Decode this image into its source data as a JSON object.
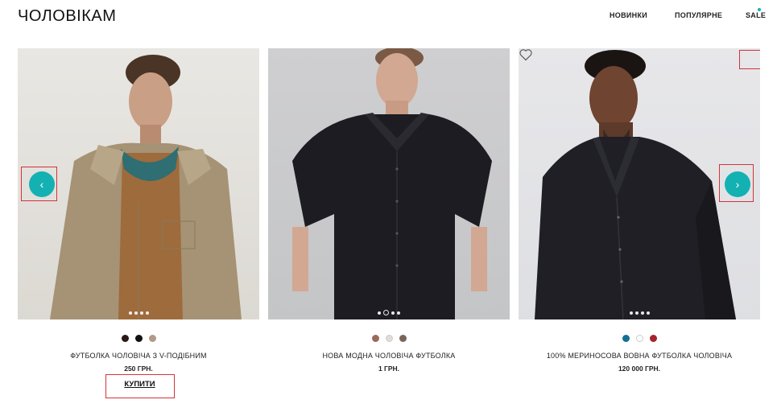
{
  "header": {
    "title": "ЧОЛОВІКАМ",
    "nav": {
      "new": "НОВИНКИ",
      "popular": "ПОПУЛЯРНЕ",
      "sale": "SALE"
    }
  },
  "accent_color": "#14b1b3",
  "highlight_color": "#d1343a",
  "icons": {
    "prev": "chevron-left-icon",
    "next": "chevron-right-icon",
    "favorite": "heart-icon"
  },
  "products": [
    {
      "name": "ФУТБОЛКА ЧОЛОВІЧА З V-ПОДІБНИМ",
      "price": "250 ГРН.",
      "buy_label": "КУПИТИ",
      "swatches": [
        "#2a1a14",
        "#111111",
        "#b49a86"
      ],
      "image_count": 4,
      "active_image": 0
    },
    {
      "name": "НОВА МОДНА ЧОЛОВІЧА ФУТБОЛКА",
      "price": "1 ГРН.",
      "swatches": [
        "#9b6a5c",
        "#e2ddd6",
        "#7a6658"
      ],
      "image_count": 4,
      "active_image": 1
    },
    {
      "name": "100% МЕРИНОСОВА ВОВНА ФУТБОЛКА ЧОЛОВІЧА",
      "price": "120 000 ГРН.",
      "swatches": [
        "#136f95",
        "#ffffff",
        "#a3242a"
      ],
      "image_count": 4,
      "active_image": 0
    }
  ]
}
